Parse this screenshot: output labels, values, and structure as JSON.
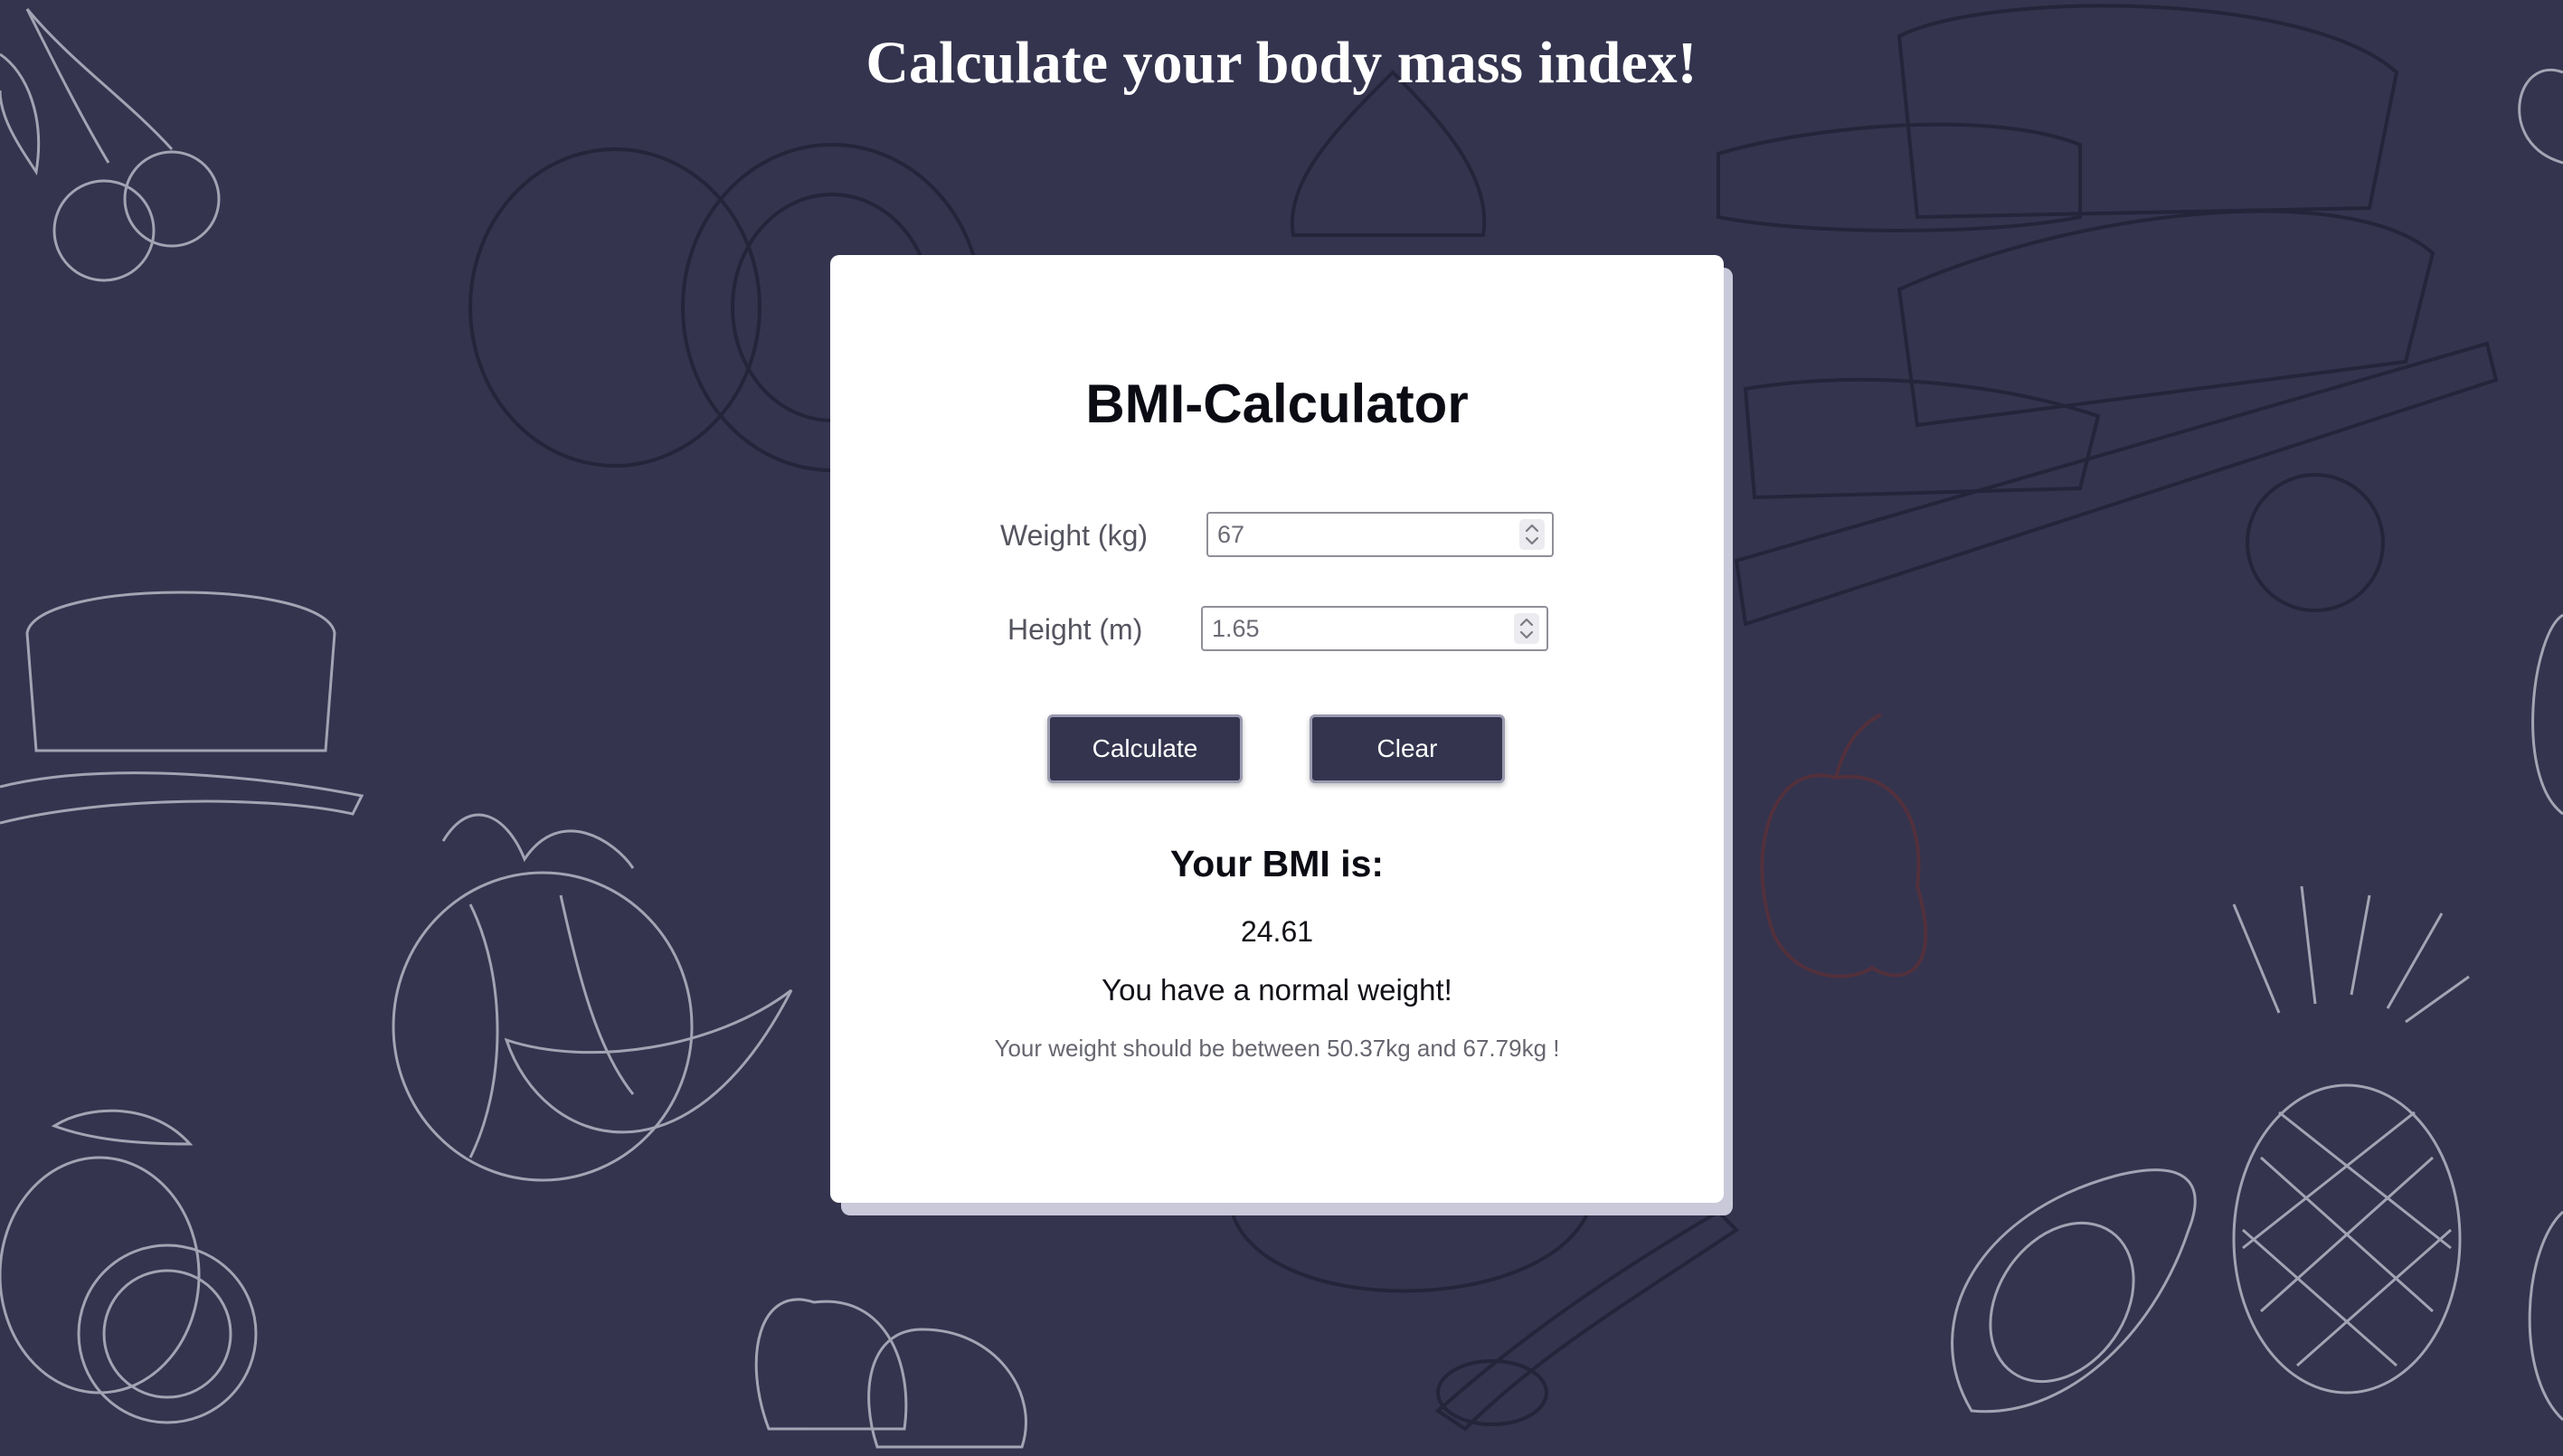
{
  "page": {
    "title": "Calculate your body mass index!",
    "background_color": "#34344f"
  },
  "card": {
    "title": "BMI-Calculator",
    "weight": {
      "label": "Weight (kg)",
      "value": "67"
    },
    "height": {
      "label": "Height (m)",
      "value": "1.65"
    },
    "buttons": {
      "calculate_label": "Calculate",
      "clear_label": "Clear"
    },
    "result": {
      "heading": "Your BMI is:",
      "value": "24.61",
      "category": "You have a normal weight!",
      "range_text": "Your weight should be between 50.37kg and 67.79kg !"
    }
  },
  "icons": {
    "spinner": "chevron-up-down-icon"
  },
  "colors": {
    "accent": "#34344f",
    "card": "#ffffff",
    "card_shadow": "#c9c9da"
  }
}
